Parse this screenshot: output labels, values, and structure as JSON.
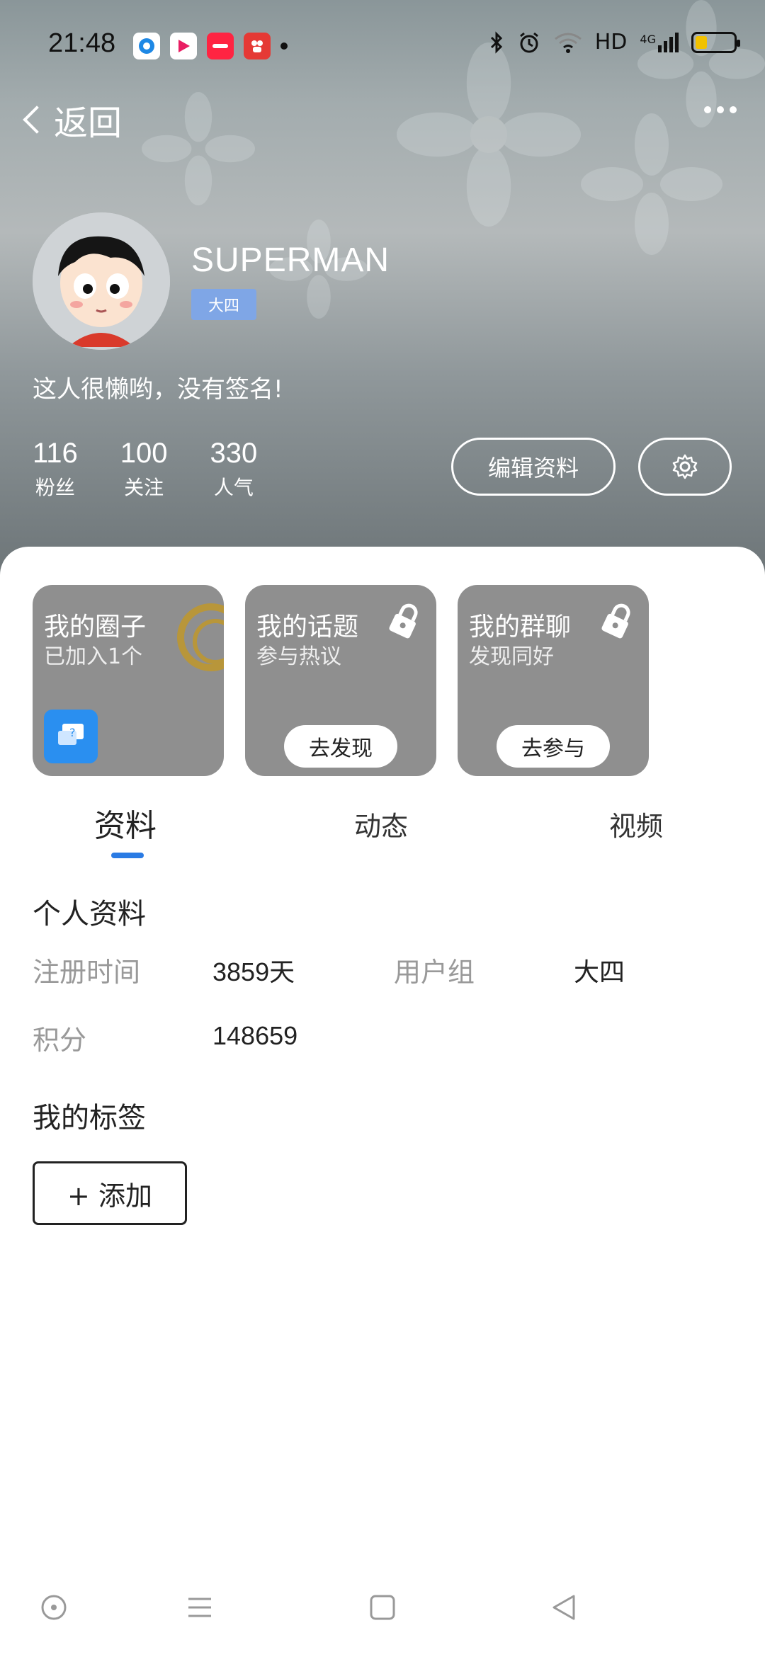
{
  "status": {
    "time": "21:48",
    "network": "HD",
    "network_gen": "4G"
  },
  "nav": {
    "back_label": "返回"
  },
  "profile": {
    "username": "SUPERMAN",
    "level": "大四",
    "signature": "这人很懒哟，没有签名!",
    "stats": [
      {
        "value": "116",
        "label": "粉丝"
      },
      {
        "value": "100",
        "label": "关注"
      },
      {
        "value": "330",
        "label": "人气"
      }
    ],
    "edit_label": "编辑资料"
  },
  "cards": [
    {
      "title": "我的圈子",
      "subtitle": "已加入1个"
    },
    {
      "title": "我的话题",
      "subtitle": "参与热议",
      "action": "去发现"
    },
    {
      "title": "我的群聊",
      "subtitle": "发现同好",
      "action": "去参与"
    }
  ],
  "tabs": [
    {
      "label": "资料"
    },
    {
      "label": "动态"
    },
    {
      "label": "视频"
    }
  ],
  "info": {
    "title": "个人资料",
    "reg_label": "注册时间",
    "reg_value": "3859天",
    "group_label": "用户组",
    "group_value": "大四",
    "points_label": "积分",
    "points_value": "148659"
  },
  "tags": {
    "title": "我的标签",
    "add_label": "+ 添加"
  },
  "colors": {
    "accent": "#2a7be4",
    "card_bg": "#8f8f8f",
    "badge_bg": "#7fa6e6"
  }
}
